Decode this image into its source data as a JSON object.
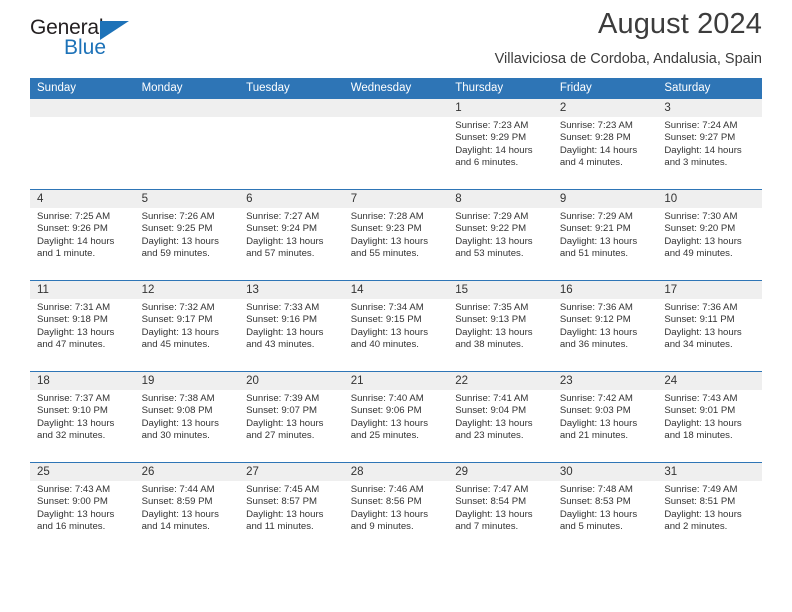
{
  "brand": {
    "name_top": "General",
    "name_bottom": "Blue",
    "accent_color": "#1d72b8"
  },
  "header": {
    "month_title": "August 2024",
    "location": "Villaviciosa de Cordoba, Andalusia, Spain"
  },
  "calendar": {
    "header_color": "#2e75b6",
    "daynum_band_color": "#efefef",
    "weekday_headers": [
      "Sunday",
      "Monday",
      "Tuesday",
      "Wednesday",
      "Thursday",
      "Friday",
      "Saturday"
    ],
    "weeks": [
      [
        {
          "day": "",
          "lines": []
        },
        {
          "day": "",
          "lines": []
        },
        {
          "day": "",
          "lines": []
        },
        {
          "day": "",
          "lines": []
        },
        {
          "day": "1",
          "lines": [
            "Sunrise: 7:23 AM",
            "Sunset: 9:29 PM",
            "Daylight: 14 hours",
            "and 6 minutes."
          ]
        },
        {
          "day": "2",
          "lines": [
            "Sunrise: 7:23 AM",
            "Sunset: 9:28 PM",
            "Daylight: 14 hours",
            "and 4 minutes."
          ]
        },
        {
          "day": "3",
          "lines": [
            "Sunrise: 7:24 AM",
            "Sunset: 9:27 PM",
            "Daylight: 14 hours",
            "and 3 minutes."
          ]
        }
      ],
      [
        {
          "day": "4",
          "lines": [
            "Sunrise: 7:25 AM",
            "Sunset: 9:26 PM",
            "Daylight: 14 hours",
            "and 1 minute."
          ]
        },
        {
          "day": "5",
          "lines": [
            "Sunrise: 7:26 AM",
            "Sunset: 9:25 PM",
            "Daylight: 13 hours",
            "and 59 minutes."
          ]
        },
        {
          "day": "6",
          "lines": [
            "Sunrise: 7:27 AM",
            "Sunset: 9:24 PM",
            "Daylight: 13 hours",
            "and 57 minutes."
          ]
        },
        {
          "day": "7",
          "lines": [
            "Sunrise: 7:28 AM",
            "Sunset: 9:23 PM",
            "Daylight: 13 hours",
            "and 55 minutes."
          ]
        },
        {
          "day": "8",
          "lines": [
            "Sunrise: 7:29 AM",
            "Sunset: 9:22 PM",
            "Daylight: 13 hours",
            "and 53 minutes."
          ]
        },
        {
          "day": "9",
          "lines": [
            "Sunrise: 7:29 AM",
            "Sunset: 9:21 PM",
            "Daylight: 13 hours",
            "and 51 minutes."
          ]
        },
        {
          "day": "10",
          "lines": [
            "Sunrise: 7:30 AM",
            "Sunset: 9:20 PM",
            "Daylight: 13 hours",
            "and 49 minutes."
          ]
        }
      ],
      [
        {
          "day": "11",
          "lines": [
            "Sunrise: 7:31 AM",
            "Sunset: 9:18 PM",
            "Daylight: 13 hours",
            "and 47 minutes."
          ]
        },
        {
          "day": "12",
          "lines": [
            "Sunrise: 7:32 AM",
            "Sunset: 9:17 PM",
            "Daylight: 13 hours",
            "and 45 minutes."
          ]
        },
        {
          "day": "13",
          "lines": [
            "Sunrise: 7:33 AM",
            "Sunset: 9:16 PM",
            "Daylight: 13 hours",
            "and 43 minutes."
          ]
        },
        {
          "day": "14",
          "lines": [
            "Sunrise: 7:34 AM",
            "Sunset: 9:15 PM",
            "Daylight: 13 hours",
            "and 40 minutes."
          ]
        },
        {
          "day": "15",
          "lines": [
            "Sunrise: 7:35 AM",
            "Sunset: 9:13 PM",
            "Daylight: 13 hours",
            "and 38 minutes."
          ]
        },
        {
          "day": "16",
          "lines": [
            "Sunrise: 7:36 AM",
            "Sunset: 9:12 PM",
            "Daylight: 13 hours",
            "and 36 minutes."
          ]
        },
        {
          "day": "17",
          "lines": [
            "Sunrise: 7:36 AM",
            "Sunset: 9:11 PM",
            "Daylight: 13 hours",
            "and 34 minutes."
          ]
        }
      ],
      [
        {
          "day": "18",
          "lines": [
            "Sunrise: 7:37 AM",
            "Sunset: 9:10 PM",
            "Daylight: 13 hours",
            "and 32 minutes."
          ]
        },
        {
          "day": "19",
          "lines": [
            "Sunrise: 7:38 AM",
            "Sunset: 9:08 PM",
            "Daylight: 13 hours",
            "and 30 minutes."
          ]
        },
        {
          "day": "20",
          "lines": [
            "Sunrise: 7:39 AM",
            "Sunset: 9:07 PM",
            "Daylight: 13 hours",
            "and 27 minutes."
          ]
        },
        {
          "day": "21",
          "lines": [
            "Sunrise: 7:40 AM",
            "Sunset: 9:06 PM",
            "Daylight: 13 hours",
            "and 25 minutes."
          ]
        },
        {
          "day": "22",
          "lines": [
            "Sunrise: 7:41 AM",
            "Sunset: 9:04 PM",
            "Daylight: 13 hours",
            "and 23 minutes."
          ]
        },
        {
          "day": "23",
          "lines": [
            "Sunrise: 7:42 AM",
            "Sunset: 9:03 PM",
            "Daylight: 13 hours",
            "and 21 minutes."
          ]
        },
        {
          "day": "24",
          "lines": [
            "Sunrise: 7:43 AM",
            "Sunset: 9:01 PM",
            "Daylight: 13 hours",
            "and 18 minutes."
          ]
        }
      ],
      [
        {
          "day": "25",
          "lines": [
            "Sunrise: 7:43 AM",
            "Sunset: 9:00 PM",
            "Daylight: 13 hours",
            "and 16 minutes."
          ]
        },
        {
          "day": "26",
          "lines": [
            "Sunrise: 7:44 AM",
            "Sunset: 8:59 PM",
            "Daylight: 13 hours",
            "and 14 minutes."
          ]
        },
        {
          "day": "27",
          "lines": [
            "Sunrise: 7:45 AM",
            "Sunset: 8:57 PM",
            "Daylight: 13 hours",
            "and 11 minutes."
          ]
        },
        {
          "day": "28",
          "lines": [
            "Sunrise: 7:46 AM",
            "Sunset: 8:56 PM",
            "Daylight: 13 hours",
            "and 9 minutes."
          ]
        },
        {
          "day": "29",
          "lines": [
            "Sunrise: 7:47 AM",
            "Sunset: 8:54 PM",
            "Daylight: 13 hours",
            "and 7 minutes."
          ]
        },
        {
          "day": "30",
          "lines": [
            "Sunrise: 7:48 AM",
            "Sunset: 8:53 PM",
            "Daylight: 13 hours",
            "and 5 minutes."
          ]
        },
        {
          "day": "31",
          "lines": [
            "Sunrise: 7:49 AM",
            "Sunset: 8:51 PM",
            "Daylight: 13 hours",
            "and 2 minutes."
          ]
        }
      ]
    ]
  }
}
